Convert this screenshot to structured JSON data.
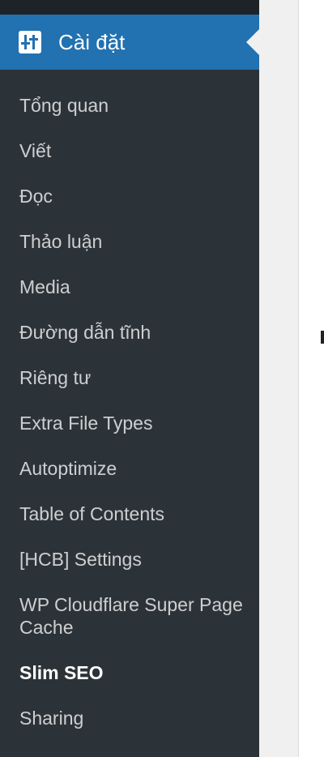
{
  "sidebar": {
    "header": {
      "icon": "settings-sliders-icon",
      "title": "Cài đặt"
    },
    "items": [
      {
        "label": "Tổng quan"
      },
      {
        "label": "Viết"
      },
      {
        "label": "Đọc"
      },
      {
        "label": "Thảo luận"
      },
      {
        "label": "Media"
      },
      {
        "label": "Đường dẫn tĩnh"
      },
      {
        "label": "Riêng tư"
      },
      {
        "label": "Extra File Types"
      },
      {
        "label": "Autoptimize"
      },
      {
        "label": "Table of Contents"
      },
      {
        "label": "[HCB] Settings"
      },
      {
        "label": "WP Cloudflare Super Page Cache"
      },
      {
        "label": "Slim SEO"
      },
      {
        "label": "Sharing"
      }
    ],
    "current_item": "Slim SEO"
  },
  "colors": {
    "sidebar_bg": "#2c3338",
    "header_bg": "#2271b1",
    "content_bg": "#f0f0f1"
  }
}
